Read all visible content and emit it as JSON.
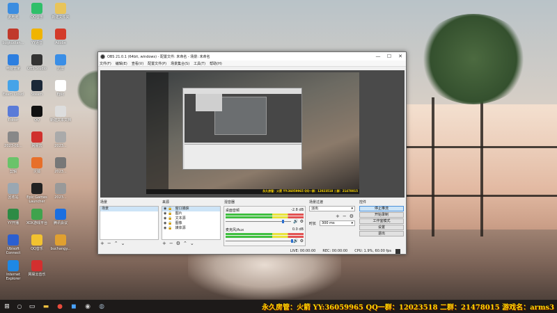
{
  "desktop_icons": [
    {
      "label": "此电脑",
      "icon": "computer-icon",
      "color": "#3b8de0"
    },
    {
      "label": "QQ音乐",
      "icon": "qq-music-icon",
      "color": "#2fbf6a"
    },
    {
      "label": "新建文件夹",
      "icon": "folder-icon",
      "color": "#e8c45a"
    },
    {
      "label": "bugkudian...",
      "icon": "app-icon",
      "color": "#c0392b"
    },
    {
      "label": "YY语音",
      "icon": "yy-icon",
      "color": "#f0b400"
    },
    {
      "label": "Adobe",
      "icon": "adobe-icon",
      "color": "#d33b2a"
    },
    {
      "label": "电脑管家",
      "icon": "shield-icon",
      "color": "#2d7fe0"
    },
    {
      "label": "OBS Studio",
      "icon": "obs-icon",
      "color": "#333333"
    },
    {
      "label": "迅雷",
      "icon": "thunder-icon",
      "color": "#3a8ee6"
    },
    {
      "label": "Exam Cloud",
      "icon": "cloud-icon",
      "color": "#46a3e8"
    },
    {
      "label": "Steam",
      "icon": "steam-icon",
      "color": "#1b2838"
    },
    {
      "label": "Epic",
      "icon": "file-icon",
      "color": "#ffffff"
    },
    {
      "label": "Editor",
      "icon": "editor-icon",
      "color": "#5a7bd8"
    },
    {
      "label": "QQ",
      "icon": "qq-icon",
      "color": "#111111"
    },
    {
      "label": "新建文本文档",
      "icon": "text-icon",
      "color": "#dddddd"
    },
    {
      "label": "2023-01...",
      "icon": "image-icon",
      "color": "#888888"
    },
    {
      "label": "网易云",
      "icon": "music-icon",
      "color": "#d0312d"
    },
    {
      "label": "2023...",
      "icon": "video-icon",
      "color": "#aaaaaa"
    },
    {
      "label": "剪辑",
      "icon": "clip-icon",
      "color": "#6ac36a"
    },
    {
      "label": "火狐",
      "icon": "browser-icon",
      "color": "#e76f2a"
    },
    {
      "label": "2023...",
      "icon": "image-icon",
      "color": "#777777"
    },
    {
      "label": "回收站",
      "icon": "trash-icon",
      "color": "#9aa7b2"
    },
    {
      "label": "Epic Games Launcher",
      "icon": "epic-icon",
      "color": "#222222"
    },
    {
      "label": "2023...",
      "icon": "image-icon",
      "color": "#999999"
    },
    {
      "label": "YY开播",
      "icon": "yy-live-icon",
      "color": "#2d8b45"
    },
    {
      "label": "XOX游戏平台",
      "icon": "game-icon",
      "color": "#3fa34d"
    },
    {
      "label": "腾讯会议",
      "icon": "meeting-icon",
      "color": "#1b6fe0"
    },
    {
      "label": "Ubisoft Connect",
      "icon": "ubisoft-icon",
      "color": "#2b5fd0"
    },
    {
      "label": "QQ音乐",
      "icon": "qq-music-icon",
      "color": "#f2c230"
    },
    {
      "label": "buchangy...",
      "icon": "doc-icon",
      "color": "#e0a030"
    },
    {
      "label": "Internet Explorer",
      "icon": "ie-icon",
      "color": "#1e88e5"
    },
    {
      "label": "网易云音乐",
      "icon": "music-icon",
      "color": "#d32f2f"
    }
  ],
  "obs": {
    "title": "OBS 21.0.1 (64bit, windows) - 配置文件: 未命名 - 场景: 未命名",
    "menu": [
      "文件(F)",
      "编辑(E)",
      "查看(V)",
      "配置文件(P)",
      "场景集合(S)",
      "工具(T)",
      "帮助(H)"
    ],
    "preview_caption": "永久房管：火箭 YY:36059965 QQ一群：12023518 二群：21478015",
    "scenes": {
      "header": "场景",
      "items": [
        "场景"
      ]
    },
    "sources": {
      "header": "来源",
      "items": [
        "窗口捕获",
        "图片",
        "文本源",
        "图像",
        "媒体源"
      ]
    },
    "mixer": {
      "header": "混音器",
      "channels": [
        {
          "name": "桌面音频",
          "db": "-2.8 dB",
          "level": 0.86
        },
        {
          "name": "麦克风/Aux",
          "db": "0.0 dB",
          "level": 1.0
        }
      ]
    },
    "transitions": {
      "header": "场景过渡",
      "type": "淡出",
      "duration_label": "时长",
      "duration_value": "300 ms"
    },
    "controls": {
      "header": "控件",
      "buttons": [
        "停止推流",
        "开始录制",
        "工作室模式",
        "设置",
        "退出"
      ]
    },
    "status": {
      "live": "LIVE: 00:00:00",
      "rec": "REC: 00:00:00",
      "cpu": "CPU: 1.9%, 60.00 fps"
    }
  },
  "ticker_text": "永久房管：火箭 YY:36059965 QQ一群：12023518 二群：21478015 游戏名：arms3"
}
